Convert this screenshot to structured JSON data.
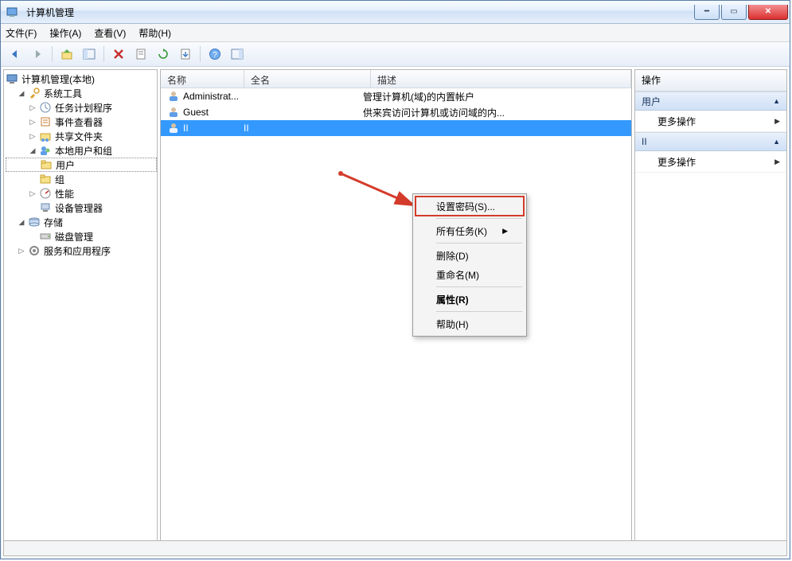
{
  "window": {
    "title": "计算机管理"
  },
  "menu": {
    "file": "文件(F)",
    "action": "操作(A)",
    "view": "查看(V)",
    "help": "帮助(H)"
  },
  "tree": {
    "root": "计算机管理(本地)",
    "system_tools": "系统工具",
    "task_scheduler": "任务计划程序",
    "event_viewer": "事件查看器",
    "shared_folders": "共享文件夹",
    "local_users_groups": "本地用户和组",
    "users": "用户",
    "groups": "组",
    "performance": "性能",
    "device_manager": "设备管理器",
    "storage": "存储",
    "disk_mgmt": "磁盘管理",
    "services_apps": "服务和应用程序"
  },
  "list": {
    "headers": {
      "name": "名称",
      "fullname": "全名",
      "description": "描述"
    },
    "rows": [
      {
        "name": "Administrat...",
        "fullname": "",
        "description": "管理计算机(域)的内置帐户"
      },
      {
        "name": "Guest",
        "fullname": "",
        "description": "供来宾访问计算机或访问域的内..."
      },
      {
        "name": "II",
        "fullname": "II",
        "description": ""
      }
    ]
  },
  "context_menu": {
    "set_password": "设置密码(S)...",
    "all_tasks": "所有任务(K)",
    "delete": "删除(D)",
    "rename": "重命名(M)",
    "properties": "属性(R)",
    "help": "帮助(H)"
  },
  "actions": {
    "title": "操作",
    "section_users": "用户",
    "more_actions": "更多操作",
    "section_selected": "II"
  }
}
